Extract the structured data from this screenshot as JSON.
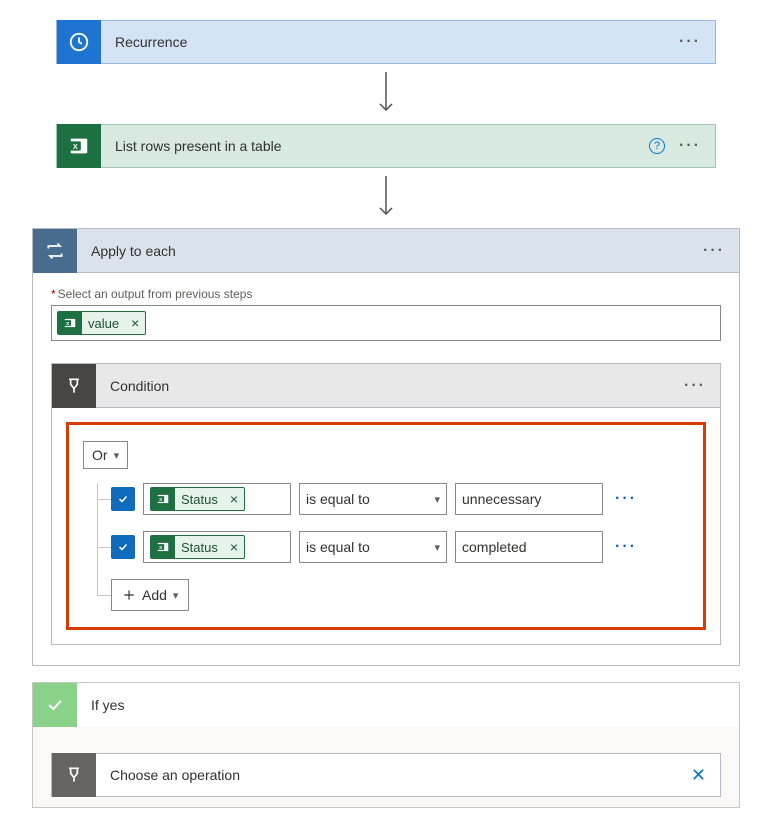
{
  "recurrence": {
    "title": "Recurrence"
  },
  "excel": {
    "title": "List rows present in a table"
  },
  "apply": {
    "title": "Apply to each",
    "select_label": "Select an output from previous steps",
    "token": "value"
  },
  "condition": {
    "title": "Condition",
    "group_operator": "Or",
    "rows": [
      {
        "field_token": "Status",
        "operator": "is equal to",
        "value": "unnecessary"
      },
      {
        "field_token": "Status",
        "operator": "is equal to",
        "value": "completed"
      }
    ],
    "add_label": "Add"
  },
  "ifyes": {
    "title": "If yes",
    "choose_label": "Choose an operation"
  }
}
